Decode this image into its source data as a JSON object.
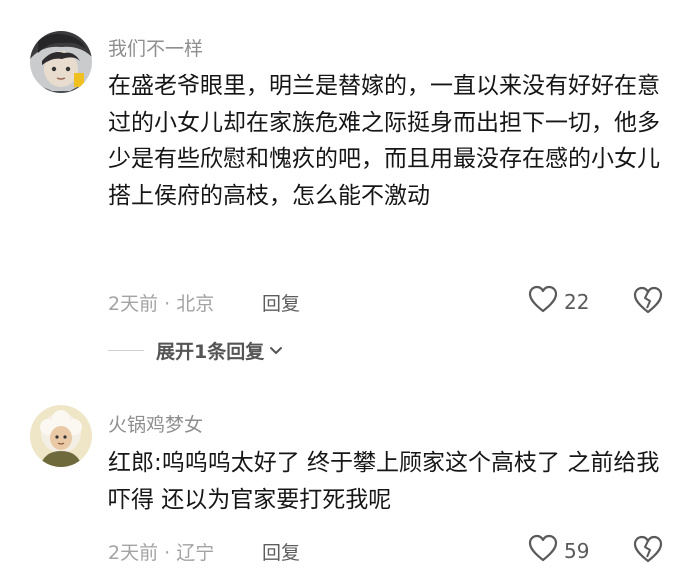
{
  "comments": [
    {
      "username": "我们不一样",
      "text": "在盛老爷眼里，明兰是替嫁的，一直以来没有好好在意过的小女儿却在家族危难之际挺身而出担下一切，他多少是有些欣慰和愧疚的吧，而且用最没存在感的小女儿搭上侯府的高枝，怎么能不激动",
      "meta": "2天前 · 北京",
      "reply_label": "回复",
      "likes": "22",
      "expand_label": "展开1条回复"
    },
    {
      "username": "火锅鸡梦女",
      "text": "红郎:呜呜呜太好了 终于攀上顾家这个高枝了 之前给我吓得 还以为官家要打死我呢",
      "meta": "2天前 · 辽宁",
      "reply_label": "回复",
      "likes": "59"
    }
  ],
  "icons": {
    "like": "heart-outline-icon",
    "dislike": "broken-heart-icon",
    "expand": "chevron-down-icon"
  }
}
